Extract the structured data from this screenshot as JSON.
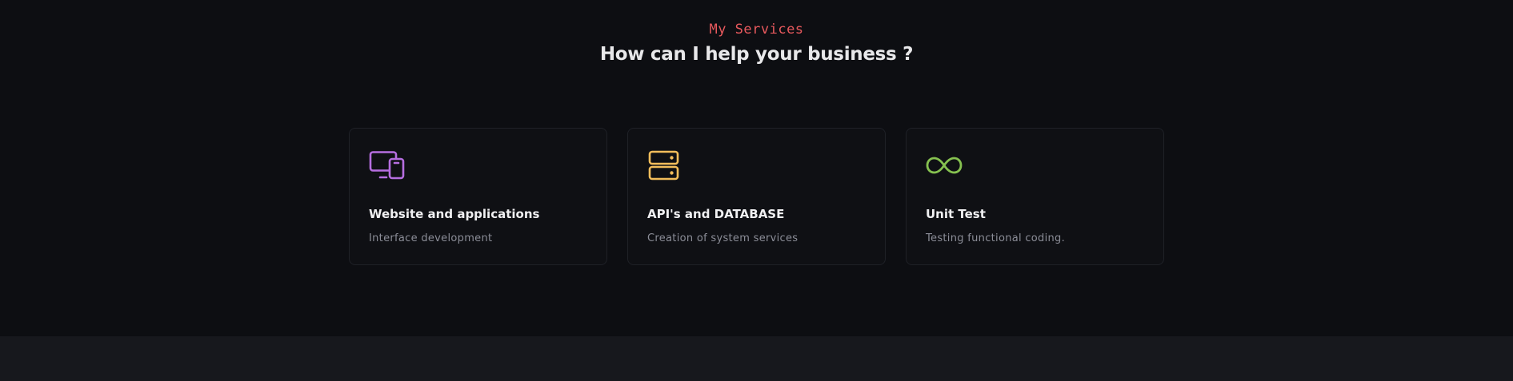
{
  "services_section": {
    "eyebrow": "My Services",
    "heading": "How can I help your business ?"
  },
  "cards": [
    {
      "icon": "devices-icon",
      "icon_color": "#b66ee0",
      "title": "Website and applications",
      "description": "Interface development"
    },
    {
      "icon": "server-icon",
      "icon_color": "#f2bd5b",
      "title": "API's and DATABASE",
      "description": "Creation of system services"
    },
    {
      "icon": "infinity-icon",
      "icon_color": "#86c150",
      "title": "Unit Test",
      "description": "Testing functional coding."
    }
  ],
  "colors": {
    "background": "#0d0e12",
    "accent": "#e8595d",
    "heading": "#e8e8ea",
    "card_border": "#1f2127",
    "muted_text": "#8b8d97",
    "footer_band": "#17181d"
  }
}
